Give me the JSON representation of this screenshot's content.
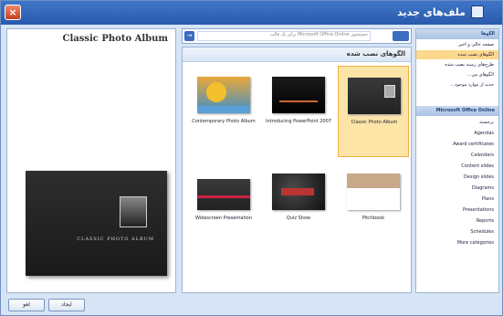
{
  "window": {
    "title": "ملف‌های جدید",
    "close_glyph": "×"
  },
  "preview": {
    "title": "Classic Photo Album",
    "caption": "CLASSIC PHOTO ALBUM"
  },
  "search": {
    "placeholder": "جستجوی Microsoft Office Online برای یک قالب",
    "button_glyph": "→"
  },
  "gallery": {
    "title": "الگوهای نصب شده",
    "templates": [
      {
        "label": "Classic Photo Album",
        "selected": true
      },
      {
        "label": "Introducing PowerPoint 2007",
        "selected": false
      },
      {
        "label": "Contemporary Photo Album",
        "selected": false
      },
      {
        "label": "Pitchbook",
        "selected": false
      },
      {
        "label": "Quiz Show",
        "selected": false
      },
      {
        "label": "Widescreen Presentation",
        "selected": false
      }
    ]
  },
  "categories": {
    "header1": "الگوها",
    "items1": [
      {
        "label": "صفحه خالی و اخیر",
        "selected": false
      },
      {
        "label": "الگوهای نصب شده",
        "selected": true
      },
      {
        "label": "طرح‌های زمینه نصب شده",
        "selected": false
      },
      {
        "label": "الگوهای من...",
        "selected": false
      },
      {
        "label": "جدید از موارد موجود...",
        "selected": false
      }
    ],
    "header2": "Microsoft Office Online",
    "items2": [
      "برجسته",
      "Agendas",
      "Award certificates",
      "Calendars",
      "Content slides",
      "Design slides",
      "Diagrams",
      "Plans",
      "Presentations",
      "Reports",
      "Schedules",
      "More categories"
    ]
  },
  "buttons": {
    "create": "ایجاد",
    "cancel": "لغو"
  }
}
